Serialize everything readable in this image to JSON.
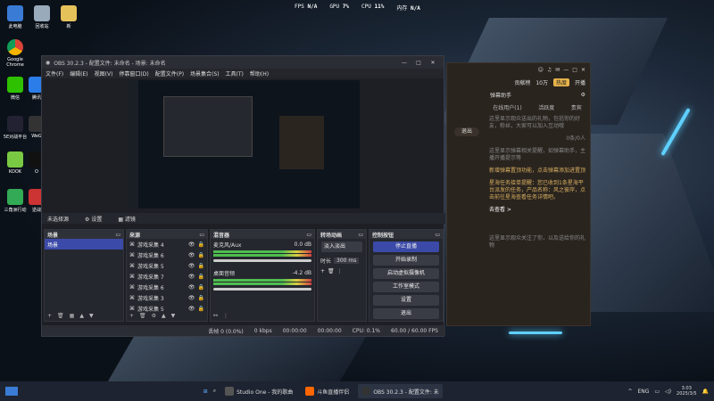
{
  "hud": {
    "fps_label": "FPS",
    "fps_val": "N/A",
    "gpu_label": "GPU",
    "gpu_val": "7%",
    "cpu_label": "CPU",
    "cpu_val": "11%",
    "mem_label": "内存",
    "mem_val": "N/A"
  },
  "desktop_icons": [
    "此电脑",
    "回收站",
    "新",
    "Google Chrome",
    "微信",
    "腾讯",
    "5E对战平台",
    "WeG",
    "KOOK",
    "O",
    "三角洲行动",
    "逆战"
  ],
  "obs": {
    "title": "OBS 30.2.3 - 配置文件: 未命名 - 场景: 未命名",
    "menus": [
      "文件(F)",
      "编辑(E)",
      "视图(V)",
      "停靠窗口(D)",
      "配置文件(P)",
      "场景集合(S)",
      "工具(T)",
      "帮助(H)"
    ],
    "scene_label": "未选择源",
    "props_btn": "设置",
    "filters_btn": "滤镜",
    "scenes": {
      "title": "场景",
      "items": [
        "场景"
      ]
    },
    "sources": {
      "title": "来源",
      "items": [
        "游戏采集 4",
        "游戏采集 6",
        "游戏采集 5",
        "游戏采集 7",
        "游戏采集 6",
        "游戏采集 3",
        "游戏采集 5"
      ]
    },
    "mixer": {
      "title": "混音器",
      "tracks": [
        {
          "name": "麦克风/Aux",
          "db": "0.0 dB"
        },
        {
          "name": "桌面音频",
          "db": "-4.2 dB"
        }
      ]
    },
    "transitions": {
      "title": "转场动画",
      "type": "淡入淡出",
      "duration_label": "时长",
      "duration": "300 ms"
    },
    "controls": {
      "title": "控制按钮",
      "buttons": [
        "停止直播",
        "开始录制",
        "启动虚拟摄像机",
        "工作室模式",
        "设置",
        "退出"
      ]
    },
    "status": {
      "frames": "丢帧 0 (0.0%)",
      "kbps": "0 kbps",
      "rec": "00:00:00",
      "stream": "00:00:00",
      "cpu": "CPU: 0.1%",
      "fps": "60.00 / 60.00 FPS"
    }
  },
  "chat": {
    "rank": "贡献榜",
    "count": "10万",
    "hot": "热度",
    "follow": "开播",
    "assistant": "弹幕助手",
    "tabs": [
      "在线用户(1)",
      "活跃度",
      "贵宾"
    ],
    "messages": [
      "这里显示观众送出的礼物，包括你的好友，粉丝，大家可以加入互动哦",
      "这里显示弹幕相关提醒，如弹幕助手，主播开播提示等",
      "新增弹幕置顶功能，点击弹幕添加进置顶",
      "星海任务接单提醒：您已收到1条星海平台派发的任务，产品名称：风之彼岸，点击前往星海查看任务详情吧。",
      "去查看 >",
      "这里显示观众关注了你，以及送给你的礼物"
    ],
    "stat": "0条/0人",
    "end_btn": "退出"
  },
  "taskbar": {
    "items": [
      "Studio One - 我的歌曲",
      "斗鱼直播伴侣",
      "OBS 30.2.3 - 配置文件: 未"
    ],
    "lang": "ENG",
    "time": "3:03",
    "date": "2025/3/5"
  }
}
